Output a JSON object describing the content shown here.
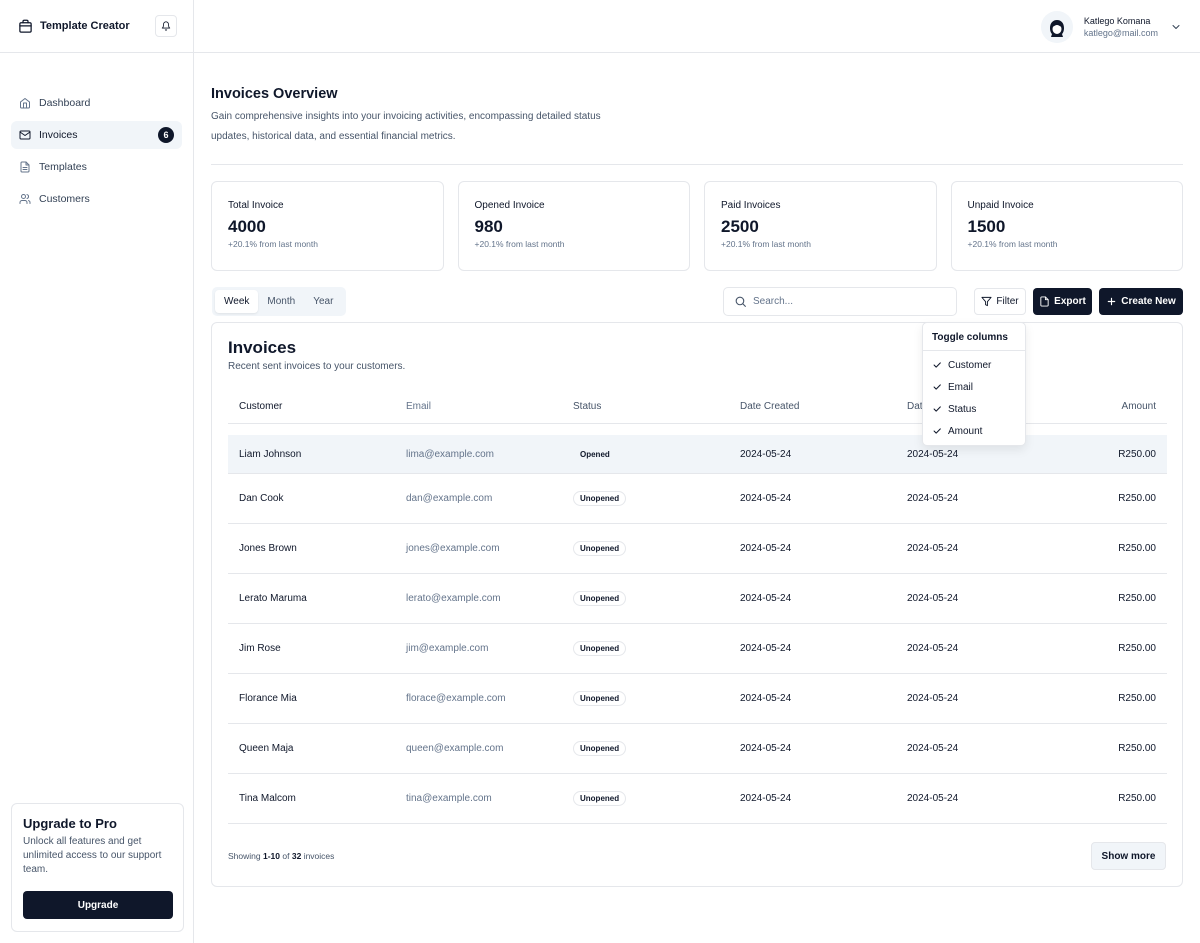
{
  "app": {
    "name": "Template Creator"
  },
  "user": {
    "name": "Katlego Komana",
    "email": "katlego@mail.com"
  },
  "nav": {
    "items": [
      {
        "label": "Dashboard",
        "icon": "home-icon"
      },
      {
        "label": "Invoices",
        "icon": "mail-icon",
        "badge": "6",
        "active": true
      },
      {
        "label": "Templates",
        "icon": "file-icon"
      },
      {
        "label": "Customers",
        "icon": "users-icon"
      }
    ]
  },
  "upgrade": {
    "title": "Upgrade to Pro",
    "text": "Unlock all features and get unlimited access to our support team.",
    "button": "Upgrade"
  },
  "page": {
    "title": "Invoices Overview",
    "description": "Gain comprehensive insights into your invoicing activities, encompassing detailed status updates, historical data, and essential financial metrics."
  },
  "stats": [
    {
      "label": "Total Invoice",
      "value": "4000",
      "delta": "+20.1% from last month"
    },
    {
      "label": "Opened Invoice",
      "value": "980",
      "delta": "+20.1% from last month"
    },
    {
      "label": "Paid Invoices",
      "value": "2500",
      "delta": "+20.1% from last month"
    },
    {
      "label": "Unpaid Invoice",
      "value": "1500",
      "delta": "+20.1% from last month"
    }
  ],
  "tabs": [
    "Week",
    "Month",
    "Year"
  ],
  "search": {
    "placeholder": "Search..."
  },
  "toolbar": {
    "filter": "Filter",
    "export": "Export",
    "create": "Create New"
  },
  "invoices": {
    "title": "Invoices",
    "subtitle": "Recent sent invoices to your customers.",
    "columns": [
      "Customer",
      "Email",
      "Status",
      "Date Created",
      "Date",
      "Amount"
    ],
    "rows": [
      {
        "customer": "Liam Johnson",
        "email": "lima@example.com",
        "status": "Opened",
        "created": "2024-05-24",
        "date": "2024-05-24",
        "amount": "R250.00"
      },
      {
        "customer": "Dan Cook",
        "email": "dan@example.com",
        "status": "Unopened",
        "created": "2024-05-24",
        "date": "2024-05-24",
        "amount": "R250.00"
      },
      {
        "customer": "Jones Brown",
        "email": "jones@example.com",
        "status": "Unopened",
        "created": "2024-05-24",
        "date": "2024-05-24",
        "amount": "R250.00"
      },
      {
        "customer": "Lerato Maruma",
        "email": "lerato@example.com",
        "status": "Unopened",
        "created": "2024-05-24",
        "date": "2024-05-24",
        "amount": "R250.00"
      },
      {
        "customer": "Jim Rose",
        "email": "jim@example.com",
        "status": "Unopened",
        "created": "2024-05-24",
        "date": "2024-05-24",
        "amount": "R250.00"
      },
      {
        "customer": "Florance Mia",
        "email": "florace@example.com",
        "status": "Unopened",
        "created": "2024-05-24",
        "date": "2024-05-24",
        "amount": "R250.00"
      },
      {
        "customer": "Queen Maja",
        "email": "queen@example.com",
        "status": "Unopened",
        "created": "2024-05-24",
        "date": "2024-05-24",
        "amount": "R250.00"
      },
      {
        "customer": "Tina Malcom",
        "email": "tina@example.com",
        "status": "Unopened",
        "created": "2024-05-24",
        "date": "2024-05-24",
        "amount": "R250.00"
      }
    ],
    "footer": {
      "prefix": "Showing",
      "range": "1-10",
      "of": "of",
      "total": "32",
      "suffix": "invoices"
    },
    "show_more": "Show more"
  },
  "toggle_columns": {
    "title": "Toggle columns",
    "items": [
      "Customer",
      "Email",
      "Status",
      "Amount"
    ]
  }
}
